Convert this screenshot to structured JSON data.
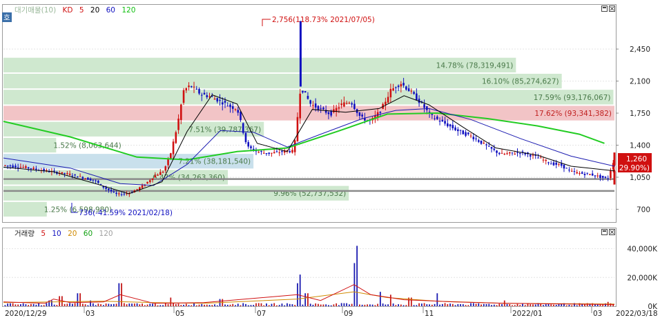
{
  "price_legend": {
    "title": "대기매물(10)",
    "items": [
      {
        "label": "KD",
        "color": "#d01010"
      },
      {
        "label": "5",
        "color": "#d01010"
      },
      {
        "label": "20",
        "color": "#000000"
      },
      {
        "label": "60",
        "color": "#1010c0"
      },
      {
        "label": "120",
        "color": "#10c010"
      }
    ]
  },
  "volume_legend": {
    "title": "거래량",
    "items": [
      {
        "label": "5",
        "color": "#d01010"
      },
      {
        "label": "10",
        "color": "#1010c0"
      },
      {
        "label": "20",
        "color": "#d08a00"
      },
      {
        "label": "60",
        "color": "#10a010"
      },
      {
        "label": "120",
        "color": "#a0a0a0"
      }
    ]
  },
  "side_tab": "호",
  "annotations": {
    "high": "2,756(118.73% 2021/07/05)",
    "low": "736(-41.59% 2021/02/18)",
    "current_price": "1,260",
    "current_change": "( 29.90%)"
  },
  "chart_data": [
    {
      "type": "candlestick",
      "title": "",
      "y_ticks": [
        {
          "value": 700,
          "label": "700"
        },
        {
          "value": 1050,
          "label": "1,050"
        },
        {
          "value": 1400,
          "label": "1,400"
        },
        {
          "value": 1750,
          "label": "1,750"
        },
        {
          "value": 2100,
          "label": "2,100"
        },
        {
          "value": 2450,
          "label": "2,450"
        }
      ],
      "x_ticks": [
        "2020/12/29",
        "03",
        "05",
        "07",
        "09",
        "11",
        "2022/01",
        "03",
        "2022/03/18"
      ],
      "ylim": [
        560,
        2820
      ],
      "close_path": [
        [
          0,
          1180
        ],
        [
          12,
          1160
        ],
        [
          25,
          1120
        ],
        [
          40,
          1080
        ],
        [
          55,
          1010
        ],
        [
          60,
          940
        ],
        [
          68,
          860
        ],
        [
          76,
          880
        ],
        [
          84,
          960
        ],
        [
          90,
          1060
        ],
        [
          96,
          1120
        ],
        [
          100,
          1300
        ],
        [
          104,
          1600
        ],
        [
          108,
          2000
        ],
        [
          112,
          2050
        ],
        [
          118,
          1960
        ],
        [
          124,
          1930
        ],
        [
          130,
          1880
        ],
        [
          136,
          1820
        ],
        [
          140,
          1800
        ],
        [
          146,
          1380
        ],
        [
          152,
          1330
        ],
        [
          158,
          1310
        ],
        [
          164,
          1320
        ],
        [
          170,
          1340
        ],
        [
          174,
          1330
        ],
        [
          178,
          2040
        ],
        [
          184,
          1850
        ],
        [
          190,
          1790
        ],
        [
          196,
          1740
        ],
        [
          202,
          1840
        ],
        [
          208,
          1880
        ],
        [
          214,
          1700
        ],
        [
          220,
          1660
        ],
        [
          226,
          1780
        ],
        [
          232,
          2000
        ],
        [
          238,
          2080
        ],
        [
          244,
          1980
        ],
        [
          250,
          1860
        ],
        [
          256,
          1720
        ],
        [
          262,
          1660
        ],
        [
          268,
          1600
        ],
        [
          274,
          1540
        ],
        [
          280,
          1500
        ],
        [
          286,
          1430
        ],
        [
          292,
          1360
        ],
        [
          298,
          1300
        ],
        [
          304,
          1310
        ],
        [
          310,
          1320
        ],
        [
          316,
          1290
        ],
        [
          322,
          1250
        ],
        [
          328,
          1200
        ],
        [
          334,
          1180
        ],
        [
          340,
          1110
        ],
        [
          346,
          1090
        ],
        [
          352,
          1080
        ],
        [
          358,
          1050
        ],
        [
          362,
          1030
        ],
        [
          366,
          1260
        ]
      ],
      "ma20_path": [
        [
          0,
          1160
        ],
        [
          30,
          1110
        ],
        [
          55,
          980
        ],
        [
          75,
          870
        ],
        [
          95,
          1000
        ],
        [
          110,
          1550
        ],
        [
          125,
          1950
        ],
        [
          140,
          1850
        ],
        [
          152,
          1420
        ],
        [
          170,
          1330
        ],
        [
          185,
          1790
        ],
        [
          205,
          1760
        ],
        [
          225,
          1800
        ],
        [
          240,
          1940
        ],
        [
          255,
          1840
        ],
        [
          275,
          1600
        ],
        [
          295,
          1370
        ],
        [
          320,
          1290
        ],
        [
          340,
          1170
        ],
        [
          366,
          1120
        ]
      ],
      "ma60_path": [
        [
          0,
          1260
        ],
        [
          40,
          1150
        ],
        [
          70,
          980
        ],
        [
          90,
          960
        ],
        [
          110,
          1190
        ],
        [
          130,
          1560
        ],
        [
          150,
          1540
        ],
        [
          170,
          1380
        ],
        [
          190,
          1520
        ],
        [
          215,
          1690
        ],
        [
          235,
          1780
        ],
        [
          255,
          1800
        ],
        [
          280,
          1680
        ],
        [
          310,
          1470
        ],
        [
          340,
          1280
        ],
        [
          366,
          1170
        ]
      ],
      "ma120_path": [
        [
          0,
          1660
        ],
        [
          40,
          1490
        ],
        [
          80,
          1270
        ],
        [
          110,
          1240
        ],
        [
          140,
          1330
        ],
        [
          170,
          1370
        ],
        [
          200,
          1550
        ],
        [
          230,
          1740
        ],
        [
          260,
          1750
        ],
        [
          290,
          1690
        ],
        [
          320,
          1610
        ],
        [
          345,
          1520
        ],
        [
          360,
          1420
        ]
      ],
      "supply_zones": [
        {
          "price": 700,
          "label": "1.25% (6,598,980)",
          "percent": 1.25,
          "volume": 6598980
        },
        {
          "price": 875,
          "label": "9.96% (52,737,532)",
          "percent": 9.96,
          "volume": 52737532
        },
        {
          "price": 1050,
          "label": "6.47% (34,263,360)",
          "percent": 6.47,
          "volume": 34263360
        },
        {
          "price": 1225,
          "label": "7.21% (38,181,540)",
          "percent": 7.21,
          "volume": 38181540
        },
        {
          "price": 1400,
          "label": "1.52% (8,063,644)",
          "percent": 1.52,
          "volume": 8063644
        },
        {
          "price": 1575,
          "label": "7.51% (39,787,367)",
          "percent": 7.51,
          "volume": 39787367
        },
        {
          "price": 1750,
          "label": "17.62% (93,341,382)",
          "percent": 17.62,
          "volume": 93341382,
          "highlight": true
        },
        {
          "price": 1925,
          "label": "17.59% (93,176,067)",
          "percent": 17.59,
          "volume": 93176067
        },
        {
          "price": 2100,
          "label": "16.10% (85,274,627)",
          "percent": 16.1,
          "volume": 85274627
        },
        {
          "price": 2275,
          "label": "14.78% (78,319,491)",
          "percent": 14.78,
          "volume": 78319491
        }
      ],
      "horizontal_levels": [
        900,
        1030
      ]
    },
    {
      "type": "bar",
      "title": "",
      "y_ticks": [
        {
          "value": 0,
          "label": "0K"
        },
        {
          "value": 20000,
          "label": "20,000K"
        },
        {
          "value": 40000,
          "label": "40,000K"
        }
      ],
      "ylim": [
        0,
        47000
      ],
      "spikes": [
        [
          28,
          4000
        ],
        [
          34,
          7000
        ],
        [
          45,
          9000
        ],
        [
          52,
          4000
        ],
        [
          70,
          16000
        ],
        [
          100,
          6000
        ],
        [
          130,
          5000
        ],
        [
          176,
          16000
        ],
        [
          178,
          22000
        ],
        [
          182,
          9000
        ],
        [
          210,
          30000
        ],
        [
          212,
          42000
        ],
        [
          226,
          10000
        ],
        [
          232,
          8000
        ],
        [
          244,
          6000
        ],
        [
          260,
          9000
        ],
        [
          300,
          4000
        ],
        [
          362,
          3000
        ]
      ],
      "ma5_path": [
        [
          0,
          3000
        ],
        [
          25,
          2000
        ],
        [
          30,
          5000
        ],
        [
          40,
          2500
        ],
        [
          60,
          3000
        ],
        [
          70,
          8000
        ],
        [
          90,
          2000
        ],
        [
          120,
          2500
        ],
        [
          176,
          8000
        ],
        [
          190,
          4000
        ],
        [
          210,
          15000
        ],
        [
          220,
          8000
        ],
        [
          240,
          4500
        ],
        [
          270,
          3000
        ],
        [
          300,
          2000
        ],
        [
          340,
          1500
        ],
        [
          366,
          1200
        ]
      ],
      "ma20_path": [
        [
          0,
          2500
        ],
        [
          30,
          3000
        ],
        [
          60,
          3500
        ],
        [
          90,
          2500
        ],
        [
          120,
          2000
        ],
        [
          176,
          5000
        ],
        [
          210,
          10000
        ],
        [
          230,
          6000
        ],
        [
          260,
          3500
        ],
        [
          300,
          2000
        ],
        [
          366,
          1500
        ]
      ]
    }
  ]
}
